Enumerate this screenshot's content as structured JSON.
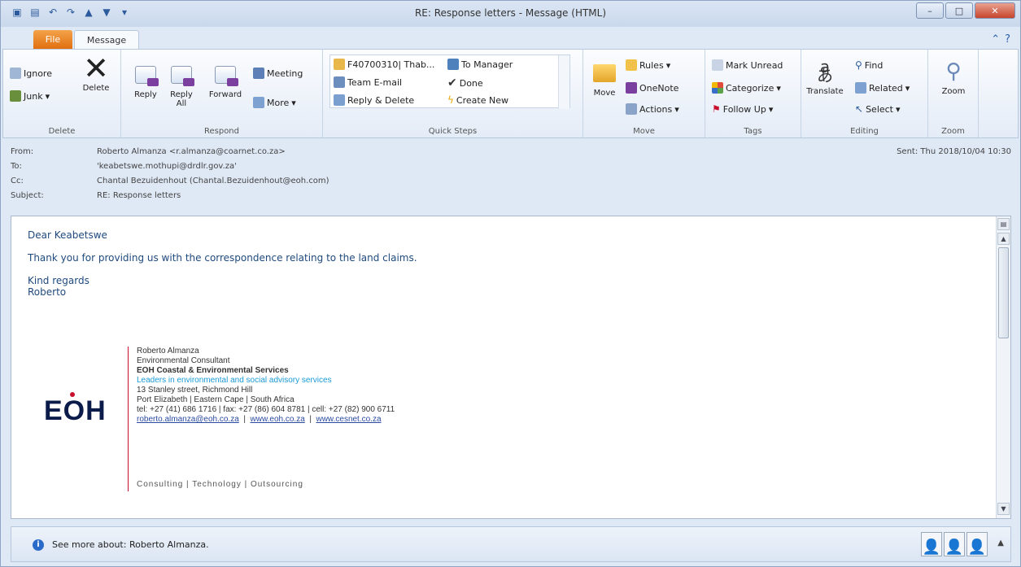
{
  "window": {
    "title": "RE: Response letters - Message (HTML)"
  },
  "tabs": {
    "file": "File",
    "message": "Message"
  },
  "ribbon": {
    "delete": {
      "label": "Delete",
      "ignore": "Ignore",
      "junk": "Junk",
      "delete_btn": "Delete"
    },
    "respond": {
      "label": "Respond",
      "reply": "Reply",
      "reply_all": "Reply All",
      "forward": "Forward",
      "meeting": "Meeting",
      "more": "More"
    },
    "quick_steps": {
      "label": "Quick Steps",
      "items": [
        "F40700310| Thab...",
        "To Manager",
        "Team E-mail",
        "Done",
        "Reply & Delete",
        "Create New"
      ]
    },
    "move": {
      "label": "Move",
      "move_btn": "Move",
      "rules": "Rules",
      "onenote": "OneNote",
      "actions": "Actions"
    },
    "tags": {
      "label": "Tags",
      "mark_unread": "Mark Unread",
      "categorize": "Categorize",
      "follow_up": "Follow Up"
    },
    "editing": {
      "label": "Editing",
      "translate": "Translate",
      "find": "Find",
      "related": "Related",
      "select": "Select"
    },
    "zoom": {
      "label": "Zoom",
      "zoom_btn": "Zoom"
    }
  },
  "header": {
    "from_label": "From:",
    "from_value": "Roberto Almanza <r.almanza@coarnet.co.za>",
    "to_label": "To:",
    "to_value": "'keabetswe.mothupi@drdlr.gov.za'",
    "cc_label": "Cc:",
    "cc_value": "Chantal Bezuidenhout (Chantal.Bezuidenhout@eoh.com)",
    "subject_label": "Subject:",
    "subject_value": "RE: Response letters",
    "sent_label": "Sent:",
    "sent_value": "Thu 2018/10/04 10:30"
  },
  "body": {
    "greeting": "Dear Keabetswe",
    "line1": "Thank you for providing us with the correspondence relating to the land claims.",
    "closing": "Kind regards",
    "name": "Roberto"
  },
  "signature": {
    "logo": "EOH",
    "name": "Roberto Almanza",
    "title": "Environmental Consultant",
    "company": "EOH Coastal & Environmental Services",
    "tagline": "Leaders in environmental and social advisory services",
    "address1": "13 Stanley street, Richmond Hill",
    "address2": "Port Elizabeth | Eastern Cape | South Africa",
    "phones": "tel: +27 (41) 686 1716 | fax: +27 (86) 604 8781 | cell: +27 (82) 900 6711",
    "email": "roberto.almanza@eoh.co.za",
    "web1": "www.eoh.co.za",
    "web2": "www.cesnet.co.za",
    "footer": "Consulting | Technology | Outsourcing"
  },
  "people_pane": {
    "see_more": "See more about: Roberto Almanza."
  }
}
